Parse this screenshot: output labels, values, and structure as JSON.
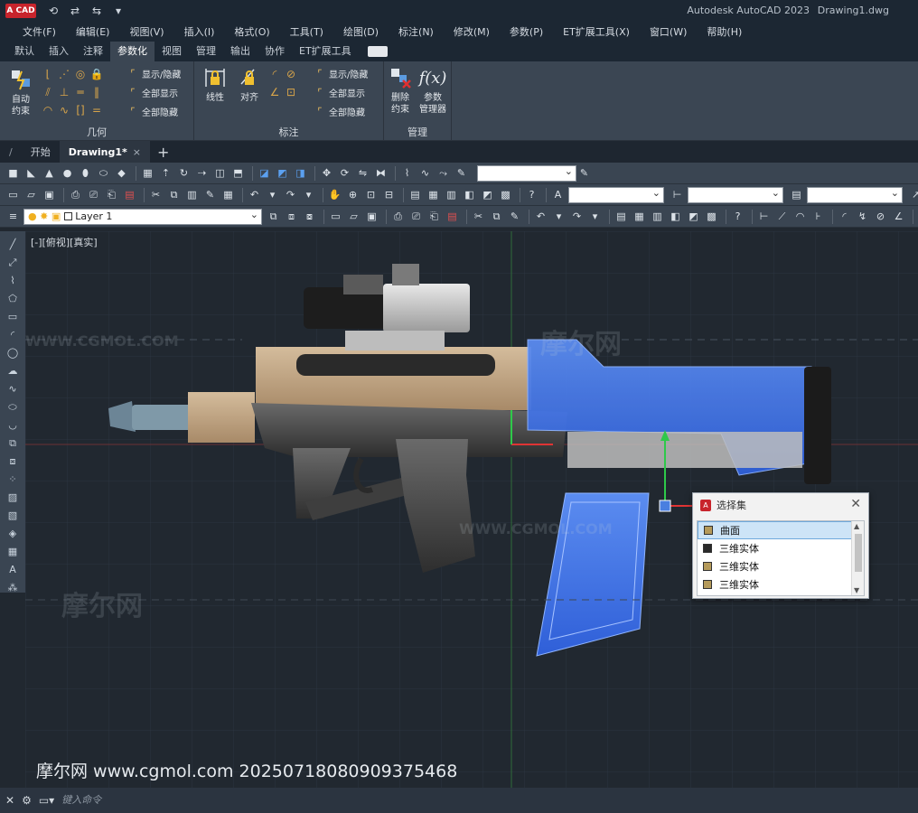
{
  "titlebar": {
    "logo": "A CAD",
    "app_name": "Autodesk AutoCAD 2023",
    "document": "Drawing1.dwg"
  },
  "menu": [
    "文件(F)",
    "编辑(E)",
    "视图(V)",
    "插入(I)",
    "格式(O)",
    "工具(T)",
    "绘图(D)",
    "标注(N)",
    "修改(M)",
    "参数(P)",
    "ET扩展工具(X)",
    "窗口(W)",
    "帮助(H)"
  ],
  "ribbon_tabs": [
    "默认",
    "插入",
    "注释",
    "参数化",
    "视图",
    "管理",
    "输出",
    "协作",
    "ET扩展工具"
  ],
  "ribbon_active_tab": "参数化",
  "ribbon": {
    "geometry": {
      "auto_constrain": "自动\n约束",
      "show_hide": "显示/隐藏",
      "show_all": "全部显示",
      "hide_all": "全部隐藏",
      "title": "几何"
    },
    "dimension": {
      "linear": "线性",
      "aligned": "对齐",
      "show_hide": "显示/隐藏",
      "show_all": "全部显示",
      "hide_all": "全部隐藏",
      "title": "标注"
    },
    "manage": {
      "delete_constraints": "删除\n约束",
      "param_manager": "参数\n管理器",
      "title": "管理"
    }
  },
  "file_tabs": [
    {
      "label": "开始",
      "active": false
    },
    {
      "label": "Drawing1*",
      "active": true
    }
  ],
  "layer_combo": "Layer 1",
  "viewport": {
    "label": "[-][俯视][真实]",
    "watermark_url": "WWW.CGMOL.COM",
    "watermark_logo": "摩尔网",
    "bottom_text": "摩尔网 www.cgmol.com 20250718080909375468"
  },
  "selection_popup": {
    "title": "选择集",
    "items": [
      {
        "label": "曲面",
        "color": "#b59a5a",
        "selected": true
      },
      {
        "label": "三维实体",
        "color": "#2a2a2a",
        "selected": false
      },
      {
        "label": "三维实体",
        "color": "#b59a5a",
        "selected": false
      },
      {
        "label": "三维实体",
        "color": "#b59a5a",
        "selected": false
      }
    ]
  },
  "command_line": {
    "placeholder": "键入命令"
  },
  "colors": {
    "selection_blue": "#3d7fff",
    "tan_body": "#c4a888",
    "dark_body": "#4a4a4a"
  }
}
